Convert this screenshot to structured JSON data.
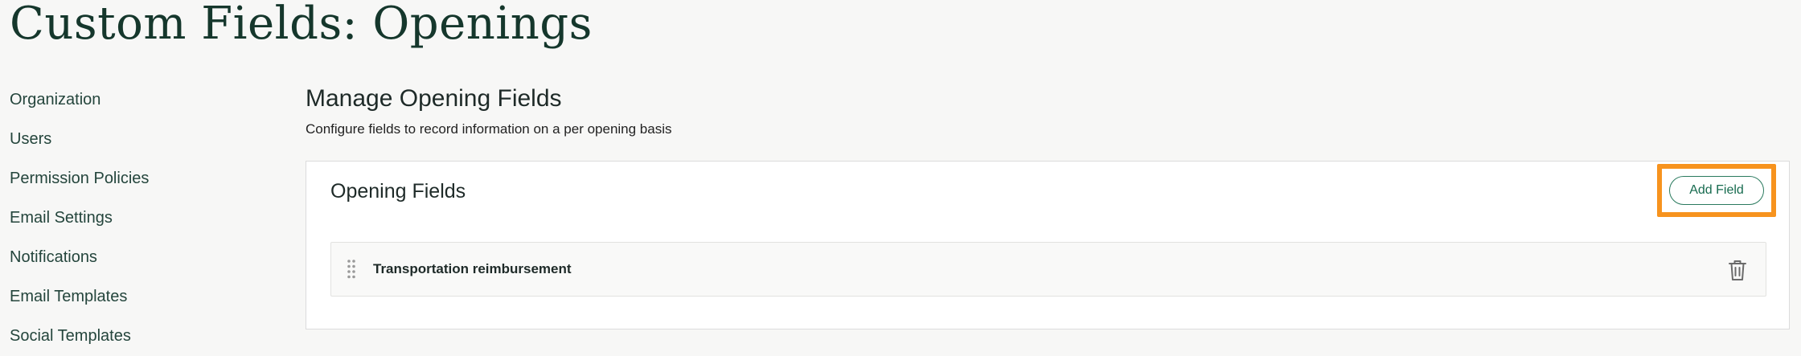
{
  "page": {
    "title": "Custom Fields: Openings"
  },
  "sidebar": {
    "items": [
      {
        "label": "Organization"
      },
      {
        "label": "Users"
      },
      {
        "label": "Permission Policies"
      },
      {
        "label": "Email Settings"
      },
      {
        "label": "Notifications"
      },
      {
        "label": "Email Templates"
      },
      {
        "label": "Social Templates"
      }
    ]
  },
  "main": {
    "title": "Manage Opening Fields",
    "description": "Configure fields to record information on a per opening basis",
    "card": {
      "title": "Opening Fields",
      "add_button_label": "Add Field",
      "fields": [
        {
          "name": "Transportation reimbursement",
          "icons": [
            "drag-handle-icon",
            "trash-icon"
          ]
        }
      ]
    }
  },
  "colors": {
    "background": "#f7f7f6",
    "title_green": "#15372c",
    "accent_green": "#176b4f",
    "highlight_orange": "#f7931e"
  }
}
